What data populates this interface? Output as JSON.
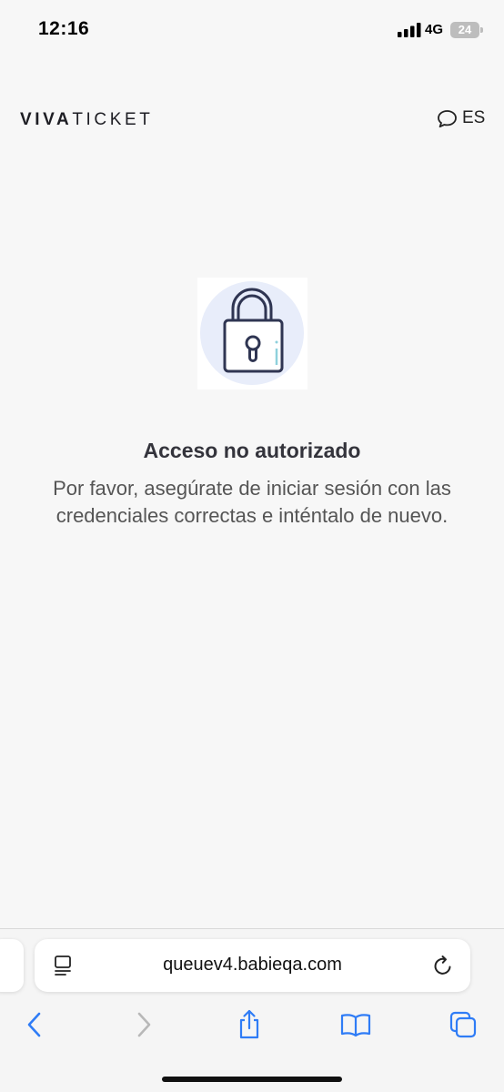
{
  "status_bar": {
    "time": "12:16",
    "network": "4G",
    "battery": "24"
  },
  "header": {
    "logo_part1": "VIVA",
    "logo_part2": "TICKET",
    "language": "ES",
    "language_icon": "chat-bubble-icon"
  },
  "message": {
    "icon": "padlock-icon",
    "title": "Acceso no autorizado",
    "body": "Por favor, asegúrate de iniciar sesión con las credenciales correctas e inténtalo de nuevo."
  },
  "browser": {
    "url": "queuev4.babieqa.com",
    "icons": [
      "reader-icon",
      "reload-icon",
      "back-icon",
      "forward-icon",
      "share-icon",
      "bookmarks-icon",
      "tabs-icon"
    ],
    "accent_color": "#2f7cf6",
    "disabled_color": "#b8b8b8"
  }
}
